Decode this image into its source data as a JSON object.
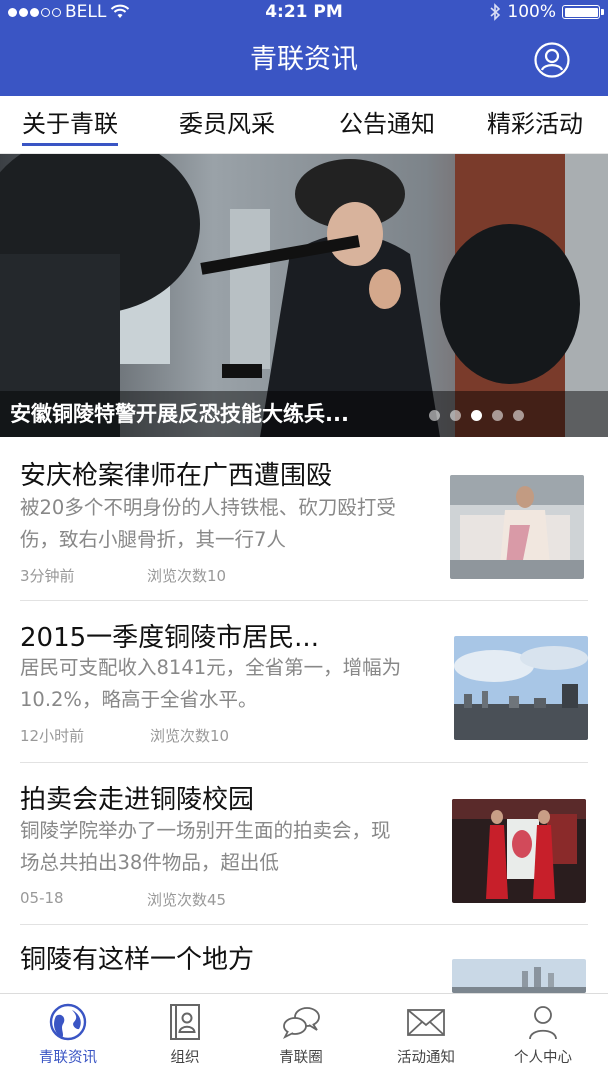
{
  "status_bar": {
    "carrier": "BELL",
    "time": "4:21 PM",
    "battery": "100%",
    "signal_strength": 3,
    "icons": [
      "wifi-icon",
      "bluetooth-icon",
      "battery-icon"
    ]
  },
  "navbar": {
    "title": "青联资讯",
    "user_icon": "user-circle-icon",
    "color": "#3a55c4"
  },
  "tabs": [
    {
      "label": "关于青联",
      "active": true
    },
    {
      "label": "委员风采"
    },
    {
      "label": "公告通知"
    },
    {
      "label": "精彩活动"
    }
  ],
  "banner": {
    "caption": "安徽铜陵特警开展反恐技能大练兵...",
    "slide_count": 5,
    "active_slide": 3
  },
  "news": [
    {
      "title": "安庆枪案律师在广西遭围殴",
      "summary": "被20多个不明身份的人持铁棍、砍刀殴打受伤，致右小腿骨折，其一行7人",
      "time": "3分钟前",
      "views": "浏览次数10"
    },
    {
      "title": "2015一季度铜陵市居民...",
      "summary": "居民可支配收入8141元，全省第一，增幅为10.2%，略高于全省水平。",
      "time": "12小时前",
      "views": "浏览次数10"
    },
    {
      "title": "拍卖会走进铜陵校园",
      "summary": "铜陵学院举办了一场别开生面的拍卖会，现场总共拍出38件物品，超出低",
      "time": "05-18",
      "views": "浏览次数45"
    },
    {
      "title": "铜陵有这样一个地方"
    }
  ],
  "tabbar": [
    {
      "label": "青联资讯",
      "icon": "globe-icon",
      "active": true
    },
    {
      "label": "组织",
      "icon": "contacts-book-icon"
    },
    {
      "label": "青联圈",
      "icon": "chat-bubbles-icon"
    },
    {
      "label": "活动通知",
      "icon": "envelope-icon"
    },
    {
      "label": "个人中心",
      "icon": "person-icon"
    }
  ]
}
